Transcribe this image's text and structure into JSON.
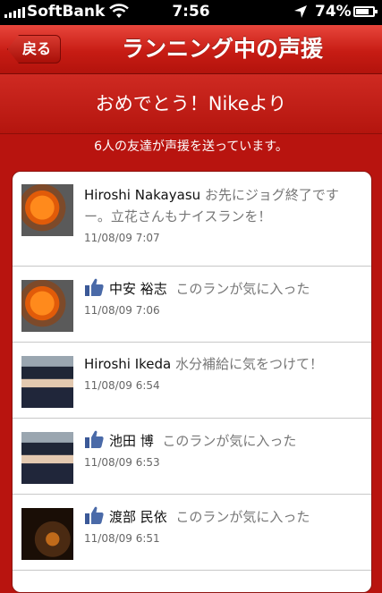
{
  "status_bar": {
    "carrier": "SoftBank",
    "time": "7:56",
    "battery": "74%"
  },
  "nav": {
    "back_label": "戻る",
    "title": "ランニング中の声援"
  },
  "banner": {
    "text": "おめでとう！Nikeより"
  },
  "subtitle": "6人の友達が声援を送っています。",
  "cheers": [
    {
      "name": "Hiroshi Nakayasu",
      "message": "お先にジョグ終了ですー。立花さんもナイスランを！",
      "time": "11/08/09  7:07",
      "like": false
    },
    {
      "name": "中安 裕志",
      "message": "このランが気に入った",
      "time": "11/08/09  7:06",
      "like": true
    },
    {
      "name": "Hiroshi Ikeda",
      "message": "水分補給に気をつけて！",
      "time": "11/08/09  6:54",
      "like": false
    },
    {
      "name": "池田 博",
      "message": "このランが気に入った",
      "time": "11/08/09  6:53",
      "like": true
    },
    {
      "name": "渡部 民依",
      "message": "このランが気に入った",
      "time": "11/08/09  6:51",
      "like": true
    }
  ],
  "colors": {
    "accent": "#c71c14",
    "like_icon": "#3b5998"
  }
}
